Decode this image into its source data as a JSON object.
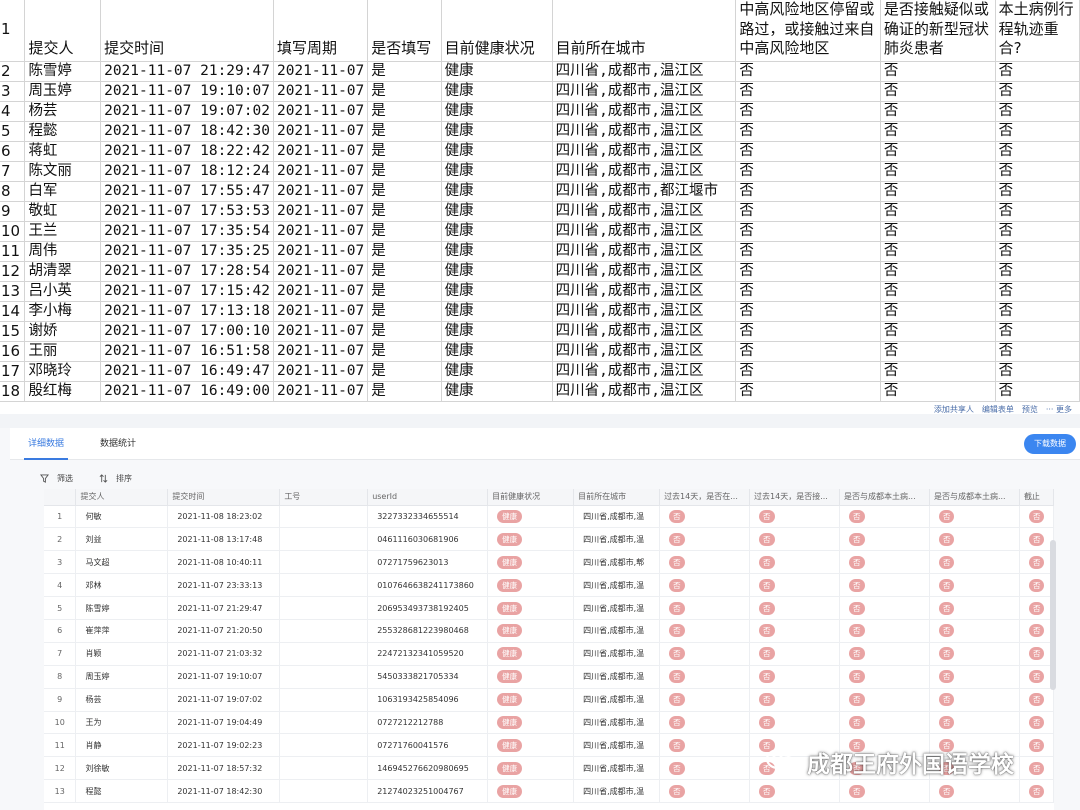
{
  "sheet": {
    "header_row_number": "1",
    "headers": [
      "提交人",
      "提交时间",
      "填写周期",
      "是否填写",
      "目前健康状况",
      "目前所在城市",
      "中高风险地区停留或路过，或接触过来自中高风险地区",
      "是否接触疑似或确证的新型冠状肺炎患者",
      "本土病例行程轨迹重合?"
    ],
    "rows": [
      [
        "2",
        "陈雪婷",
        "2021-11-07 21:29:47",
        "2021-11-07",
        "是",
        "健康",
        "四川省,成都市,温江区",
        "否",
        "否",
        "否"
      ],
      [
        "3",
        "周玉婷",
        "2021-11-07 19:10:07",
        "2021-11-07",
        "是",
        "健康",
        "四川省,成都市,温江区",
        "否",
        "否",
        "否"
      ],
      [
        "4",
        "杨芸",
        "2021-11-07 19:07:02",
        "2021-11-07",
        "是",
        "健康",
        "四川省,成都市,温江区",
        "否",
        "否",
        "否"
      ],
      [
        "5",
        "程懿",
        "2021-11-07 18:42:30",
        "2021-11-07",
        "是",
        "健康",
        "四川省,成都市,温江区",
        "否",
        "否",
        "否"
      ],
      [
        "6",
        "蒋虹",
        "2021-11-07 18:22:42",
        "2021-11-07",
        "是",
        "健康",
        "四川省,成都市,温江区",
        "否",
        "否",
        "否"
      ],
      [
        "7",
        "陈文丽",
        "2021-11-07 18:12:24",
        "2021-11-07",
        "是",
        "健康",
        "四川省,成都市,温江区",
        "否",
        "否",
        "否"
      ],
      [
        "8",
        "白军",
        "2021-11-07 17:55:47",
        "2021-11-07",
        "是",
        "健康",
        "四川省,成都市,都江堰市",
        "否",
        "否",
        "否"
      ],
      [
        "9",
        "敬虹",
        "2021-11-07 17:53:53",
        "2021-11-07",
        "是",
        "健康",
        "四川省,成都市,温江区",
        "否",
        "否",
        "否"
      ],
      [
        "10",
        "王兰",
        "2021-11-07 17:35:54",
        "2021-11-07",
        "是",
        "健康",
        "四川省,成都市,温江区",
        "否",
        "否",
        "否"
      ],
      [
        "11",
        "周伟",
        "2021-11-07 17:35:25",
        "2021-11-07",
        "是",
        "健康",
        "四川省,成都市,温江区",
        "否",
        "否",
        "否"
      ],
      [
        "12",
        "胡清翠",
        "2021-11-07 17:28:54",
        "2021-11-07",
        "是",
        "健康",
        "四川省,成都市,温江区",
        "否",
        "否",
        "否"
      ],
      [
        "13",
        "吕小英",
        "2021-11-07 17:15:42",
        "2021-11-07",
        "是",
        "健康",
        "四川省,成都市,温江区",
        "否",
        "否",
        "否"
      ],
      [
        "14",
        "李小梅",
        "2021-11-07 17:13:18",
        "2021-11-07",
        "是",
        "健康",
        "四川省,成都市,温江区",
        "否",
        "否",
        "否"
      ],
      [
        "15",
        "谢娇",
        "2021-11-07 17:00:10",
        "2021-11-07",
        "是",
        "健康",
        "四川省,成都市,温江区",
        "否",
        "否",
        "否"
      ],
      [
        "16",
        "王丽",
        "2021-11-07 16:51:58",
        "2021-11-07",
        "是",
        "健康",
        "四川省,成都市,温江区",
        "否",
        "否",
        "否"
      ],
      [
        "17",
        "邓晓玲",
        "2021-11-07 16:49:47",
        "2021-11-07",
        "是",
        "健康",
        "四川省,成都市,温江区",
        "否",
        "否",
        "否"
      ],
      [
        "18",
        "殷红梅",
        "2021-11-07 16:49:00",
        "2021-11-07",
        "是",
        "健康",
        "四川省,成都市,温江区",
        "否",
        "否",
        "否"
      ]
    ]
  },
  "strip": {
    "links": [
      "添加共享人",
      "编辑表单",
      "预览",
      "··· 更多"
    ]
  },
  "panel": {
    "tabs": [
      "详细数据",
      "数据统计"
    ],
    "download_label": "下载数据",
    "filter_label": "筛选",
    "sort_label": "排序",
    "columns": [
      "提交人",
      "提交时间",
      "工号",
      "userId",
      "目前健康状况",
      "目前所在城市",
      "过去14天，是否在...",
      "过去14天，是否接...",
      "是否与成都本土病...",
      "是否与成都本土病...",
      "截止"
    ],
    "rows": [
      [
        "1",
        "何敏",
        "2021-11-08 18:23:02",
        "",
        "3227332334655514",
        "健康",
        "四川省,成都市,温",
        "否",
        "否",
        "否",
        "否",
        "否"
      ],
      [
        "2",
        "刘益",
        "2021-11-08 13:17:48",
        "",
        "0461116030681906",
        "健康",
        "四川省,成都市,温",
        "否",
        "否",
        "否",
        "否",
        "否"
      ],
      [
        "3",
        "马文超",
        "2021-11-08 10:40:11",
        "",
        "07271759623013",
        "健康",
        "四川省,成都市,郫",
        "否",
        "否",
        "否",
        "否",
        "否"
      ],
      [
        "4",
        "邓林",
        "2021-11-07 23:33:13",
        "",
        "0107646638241173860",
        "健康",
        "四川省,成都市,温",
        "否",
        "否",
        "否",
        "否",
        "否"
      ],
      [
        "5",
        "陈雪婷",
        "2021-11-07 21:29:47",
        "",
        "206953493738192405",
        "健康",
        "四川省,成都市,温",
        "否",
        "否",
        "否",
        "否",
        "否"
      ],
      [
        "6",
        "崔萍萍",
        "2021-11-07 21:20:50",
        "",
        "255328681223980468",
        "健康",
        "四川省,成都市,温",
        "否",
        "否",
        "否",
        "否",
        "否"
      ],
      [
        "7",
        "肖颖",
        "2021-11-07 21:03:32",
        "",
        "22472132341059520",
        "健康",
        "四川省,成都市,温",
        "否",
        "否",
        "否",
        "否",
        "否"
      ],
      [
        "8",
        "周玉婷",
        "2021-11-07 19:10:07",
        "",
        "5450333821705334",
        "健康",
        "四川省,成都市,温",
        "否",
        "否",
        "否",
        "否",
        "否"
      ],
      [
        "9",
        "杨芸",
        "2021-11-07 19:07:02",
        "",
        "1063193425854096",
        "健康",
        "四川省,成都市,温",
        "否",
        "否",
        "否",
        "否",
        "否"
      ],
      [
        "10",
        "王为",
        "2021-11-07 19:04:49",
        "",
        "0727212212788",
        "健康",
        "四川省,成都市,温",
        "否",
        "否",
        "否",
        "否",
        "否"
      ],
      [
        "11",
        "肖静",
        "2021-11-07 19:02:23",
        "",
        "07271760041576",
        "健康",
        "四川省,成都市,温",
        "否",
        "否",
        "否",
        "否",
        "否"
      ],
      [
        "12",
        "刘徐敏",
        "2021-11-07 18:57:32",
        "",
        "146945276620980695",
        "健康",
        "四川省,成都市,温",
        "否",
        "否",
        "否",
        "否",
        "否"
      ],
      [
        "13",
        "程懿",
        "2021-11-07 18:42:30",
        "",
        "21274023251004767",
        "健康",
        "四川省,成都市,温",
        "否",
        "否",
        "否",
        "否",
        "否"
      ]
    ]
  },
  "watermark": {
    "text": "成都王府外国语学校"
  }
}
